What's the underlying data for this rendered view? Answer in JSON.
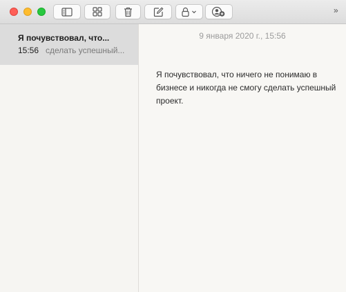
{
  "toolbar": {
    "traffic_lights": [
      "close",
      "minimize",
      "zoom"
    ],
    "buttons": [
      {
        "name": "toggle-sidebar",
        "icon": "sidebar-icon"
      },
      {
        "name": "gallery-view",
        "icon": "grid-icon"
      },
      {
        "name": "delete-note",
        "icon": "trash-icon"
      },
      {
        "name": "new-note",
        "icon": "compose-icon"
      },
      {
        "name": "lock-note",
        "icon": "lock-icon"
      },
      {
        "name": "add-people",
        "icon": "add-person-icon"
      }
    ],
    "overflow": "»"
  },
  "notes_list": [
    {
      "title": "Я почувствовал, что...",
      "time": "15:56",
      "snippet": "сделать успешный...",
      "selected": true
    }
  ],
  "editor": {
    "date": "9 января 2020 г., 15:56",
    "body": "Я почувствовал, что ничего не понимаю в бизнесе и никогда не смогу сделать успешный проект."
  },
  "colors": {
    "close": "#fe5f57",
    "minimize": "#febc2e",
    "zoom": "#28c840",
    "selected_row": "#dcdcdc"
  }
}
